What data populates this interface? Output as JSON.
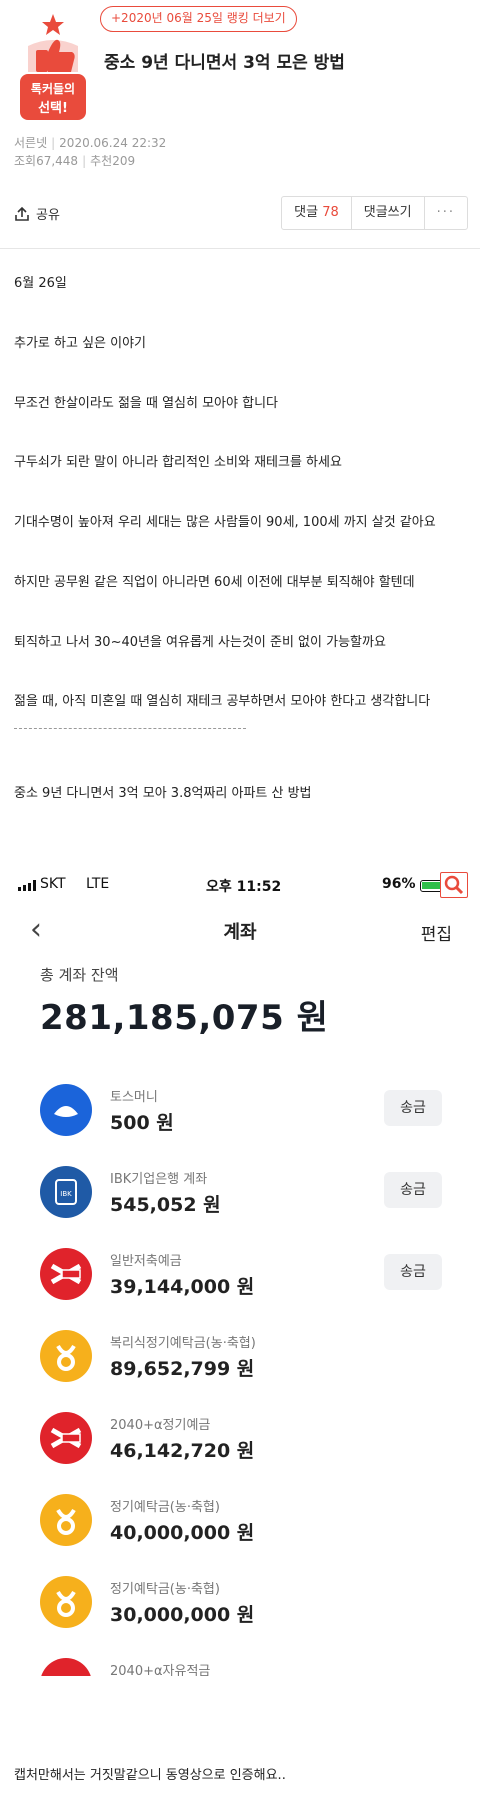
{
  "ranking_link": "+2020년 06월 25일 랭킹 더보기",
  "badge_text": [
    "톡커들의",
    "선택!"
  ],
  "post": {
    "title": "중소 9년 다니면서 3억 모은 방법",
    "author": "서른넷",
    "date": "2020.06.24 22:32",
    "views": "조회67,448",
    "recommends": "추천209"
  },
  "actions": {
    "share": "공유",
    "comments_label": "댓글",
    "comments_count": "78",
    "write_comment": "댓글쓰기",
    "more": "···"
  },
  "paragraphs": [
    "6월 26일",
    "추가로 하고 싶은 이야기",
    "무조건 한살이라도 젊을 때 열심히 모아야 합니다",
    "구두쇠가 되란 말이 아니라 합리적인 소비와 재테크를 하세요",
    "기대수명이 높아져 우리 세대는 많은 사람들이 90세, 100세 까지 살것 같아요",
    "하지만 공무원 같은 직업이 아니라면 60세 이전에 대부분 퇴직해야 할텐데",
    "퇴직하고 나서 30~40년을 여유롭게 사는것이 준비 없이 가능할까요",
    "젊을 때, 아직 미혼일 때 열심히 재테크 공부하면서 모아야 한다고 생각합니다",
    "중소 9년 다니면서 3억 모아 3.8억짜리 아파트 산 방법"
  ],
  "phone": {
    "carrier": "SKT",
    "network": "LTE",
    "time": "오후 11:52",
    "battery": "96%",
    "nav_title": "계좌",
    "edit": "편집",
    "total_label": "총 계좌 잔액",
    "total_amount": "281,185,075 원",
    "send_label": "송금",
    "accounts": [
      {
        "name": "토스머니",
        "amount": "500 원",
        "icon": "toss-icon",
        "send": true
      },
      {
        "name": "IBK기업은행 계좌",
        "amount": "545,052 원",
        "icon": "ibk-icon",
        "send": true
      },
      {
        "name": "일반저축예금",
        "amount": "39,144,000 원",
        "icon": "kb-icon",
        "send": true
      },
      {
        "name": "복리식정기예탁금(농·축협)",
        "amount": "89,652,799 원",
        "icon": "nh-icon",
        "send": false
      },
      {
        "name": "2040+α정기예금",
        "amount": "46,142,720 원",
        "icon": "kb-icon",
        "send": false
      },
      {
        "name": "정기예탁금(농·축협)",
        "amount": "40,000,000 원",
        "icon": "nh-icon",
        "send": false
      },
      {
        "name": "정기예탁금(농·축협)",
        "amount": "30,000,000 원",
        "icon": "nh-icon",
        "send": false
      },
      {
        "name": "2040+α자유적금",
        "amount": "",
        "icon": "kb-icon",
        "send": false
      }
    ]
  },
  "footer_text": "캡처만해서는 거짓말같으니 동영상으로 인증해요..",
  "colors": {
    "accent": "#e94b3c",
    "toss": "#1b64da",
    "ibk": "#1f5aa6",
    "kb_red": "#e0232b",
    "nh_yellow": "#f6b01c"
  }
}
